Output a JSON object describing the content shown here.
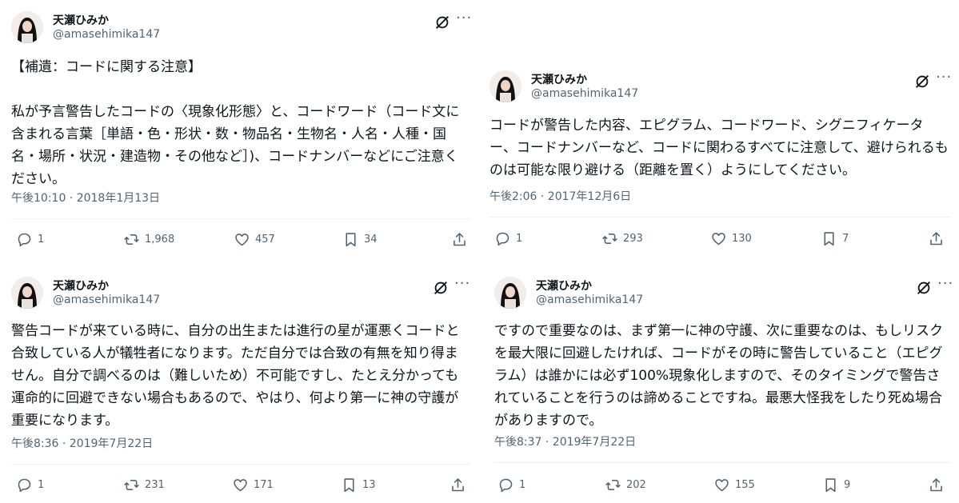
{
  "tweets": [
    {
      "name": "天瀬ひみか",
      "handle": "@amasehimika147",
      "text": "【補遺：コードに関する注意】\n\n私が予言警告したコードの〈現象化形態〉と、コードワード（コード文に含まれる言葉［単語・色・形状・数・物品名・生物名・人名・人種・国名・場所・状況・建造物・その他など］)、コードナンバーなどにご注意ください。",
      "timestamp": "午後10:10 · 2018年1月13日",
      "replies": "1",
      "reposts": "1,968",
      "likes": "457",
      "bookmarks": "34"
    },
    {
      "name": "天瀬ひみか",
      "handle": "@amasehimika147",
      "text": "コードが警告した内容、エピグラム、コードワード、シグニフィケーター、コードナンバーなど、コードに関わるすべてに注意して、避けられるものは可能な限り避ける（距離を置く）ようにしてください。",
      "timestamp": "午後2:06 · 2017年12月6日",
      "replies": "1",
      "reposts": "293",
      "likes": "130",
      "bookmarks": "7"
    },
    {
      "name": "天瀬ひみか",
      "handle": "@amasehimika147",
      "text": "警告コードが来ている時に、自分の出生または進行の星が運悪くコードと合致している人が犠牲者になります。ただ自分では合致の有無を知り得ません。自分で調べるのは（難しいため）不可能ですし、たとえ分かっても運命的に回避できない場合もあるので、やはり、何より第一に神の守護が重要になります。",
      "timestamp": "午後8:36 · 2019年7月22日",
      "replies": "1",
      "reposts": "231",
      "likes": "171",
      "bookmarks": "13"
    },
    {
      "name": "天瀬ひみか",
      "handle": "@amasehimika147",
      "text": "ですので重要なのは、まず第一に神の守護、次に重要なのは、もしリスクを最大限に回避したければ、コードがその時に警告していること（エピグラム）は誰かには必ず100%現象化しますので、そのタイミングで警告されていることを行うのは諦めることですね。最悪大怪我をしたり死ぬ場合がありますので。",
      "timestamp": "午後8:37 · 2019年7月22日",
      "replies": "1",
      "reposts": "202",
      "likes": "155",
      "bookmarks": "9"
    }
  ],
  "icons": {
    "grok": "grok-icon",
    "more": "more-icon",
    "reply": "reply-icon",
    "repost": "repost-icon",
    "like": "like-icon",
    "bookmark": "bookmark-icon",
    "share": "share-icon"
  },
  "colors": {
    "text": "#0f1419",
    "secondary": "#536471",
    "divider": "#eff3f4"
  }
}
